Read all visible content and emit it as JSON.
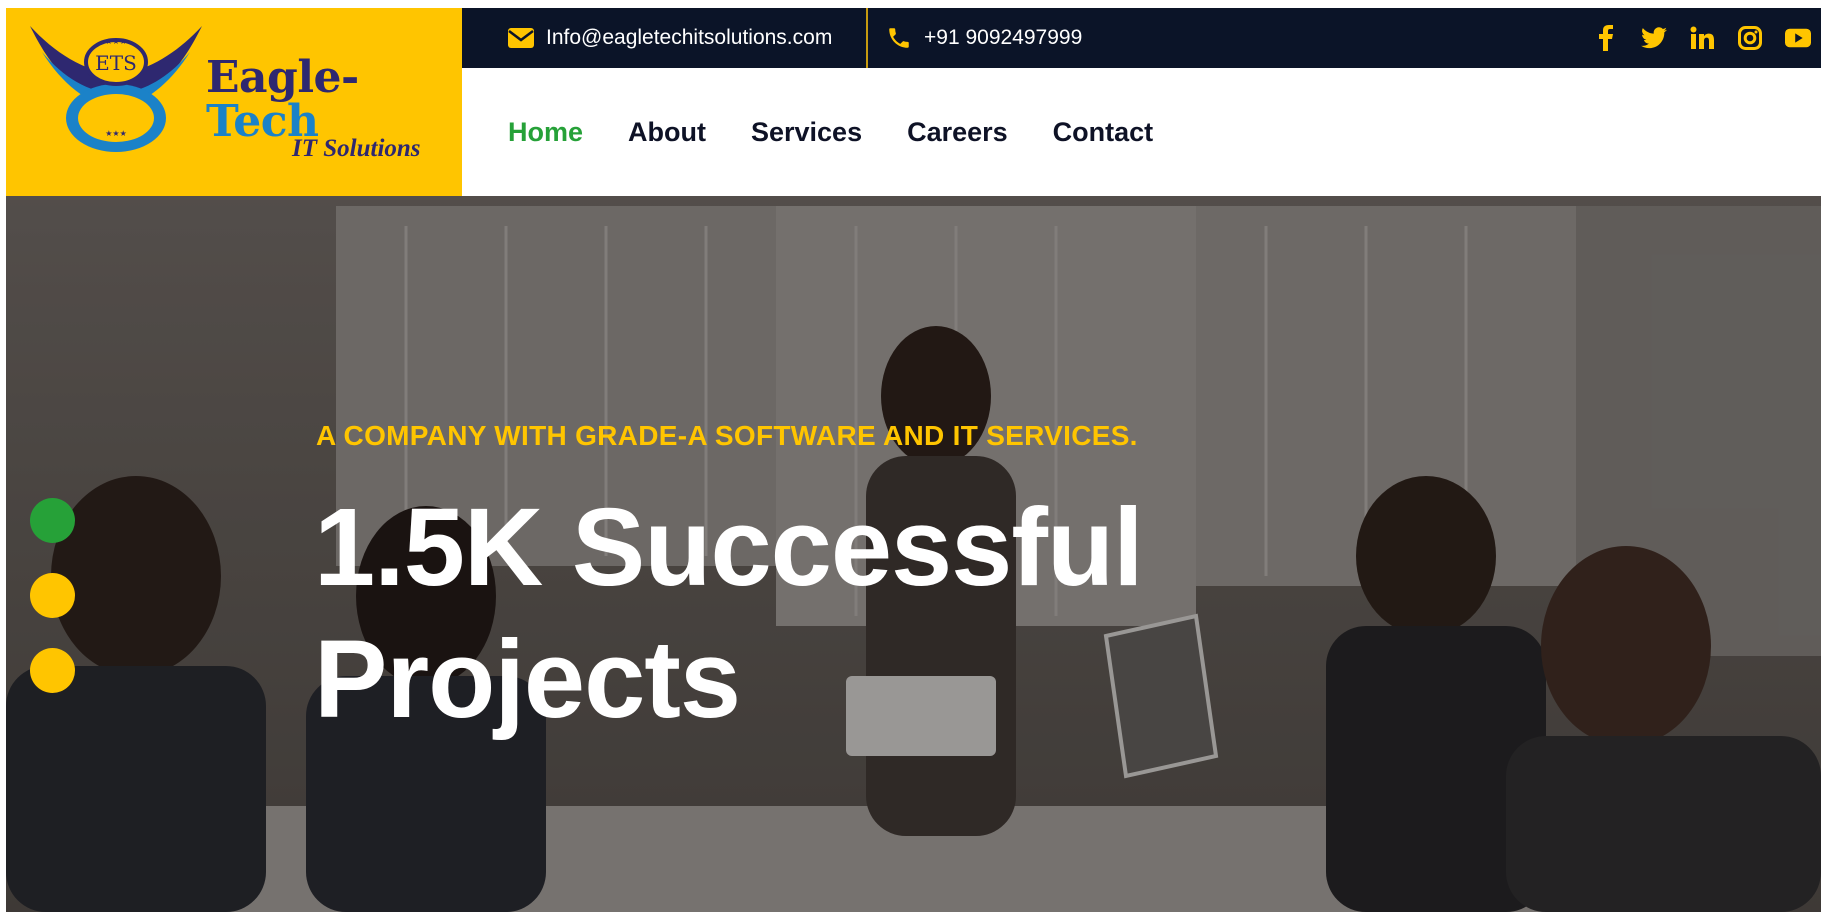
{
  "brand": {
    "emblem_text": "ETS",
    "name_part1": "Eagle-",
    "name_part2": "Tech",
    "tagline": "IT Solutions"
  },
  "topbar": {
    "email": "Info@eagletechitsolutions.com",
    "email_icon": "envelope-icon",
    "phone": "+91 9092497999",
    "phone_icon": "phone-icon",
    "socials": [
      "facebook-icon",
      "twitter-icon",
      "linkedin-icon",
      "instagram-icon",
      "youtube-icon"
    ]
  },
  "nav": {
    "items": [
      {
        "label": "Home",
        "active": true
      },
      {
        "label": "About"
      },
      {
        "label": "Services"
      },
      {
        "label": "Careers"
      },
      {
        "label": "Contact"
      }
    ]
  },
  "hero": {
    "eyebrow": "A COMPANY WITH GRADE-A SOFTWARE AND IT SERVICES.",
    "title_line1": "1.5K Successful",
    "title_line2": "Projects",
    "slides": 3,
    "active_slide": 1
  },
  "colors": {
    "accent_yellow": "#ffc500",
    "accent_green": "#26a138",
    "topbar_bg": "#0b1428",
    "nav_text": "#0e1226"
  }
}
